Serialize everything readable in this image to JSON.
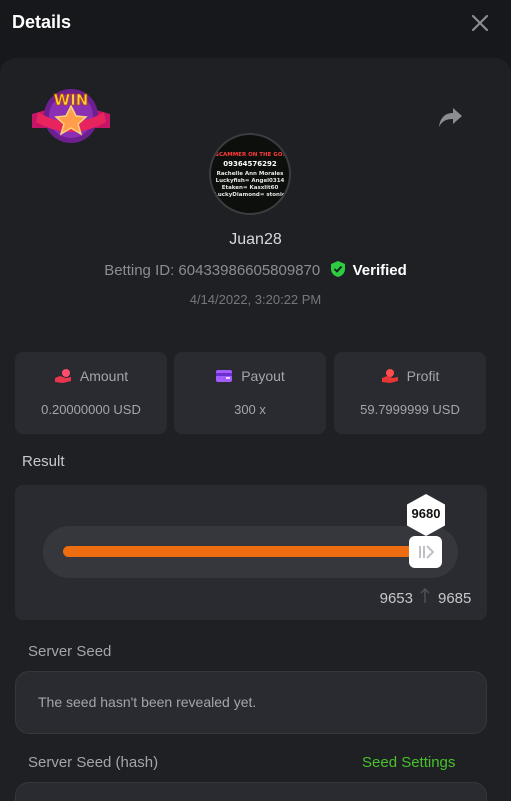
{
  "header": {
    "title": "Details"
  },
  "badge": {
    "text": "WIN"
  },
  "avatar": {
    "lines": [
      "SCAMMER ON THE GO!",
      "09364576292",
      "Rachelle Ann Morales",
      "Luckyfish= Angel0314",
      "Etaken= Kasxlit60",
      "LuckyDiamond= stonio"
    ]
  },
  "user": {
    "username": "Juan28",
    "betting_id_label": "Betting ID:",
    "betting_id": "60433986605809870",
    "verified_label": "Verified",
    "date": "4/14/2022, 3:20:22 PM"
  },
  "stats": [
    {
      "label": "Amount",
      "value": "0.20000000 USD",
      "icon": "hand-coin-icon"
    },
    {
      "label": "Payout",
      "value": "300 x",
      "icon": "wallet-icon"
    },
    {
      "label": "Profit",
      "value": "59.7999999 USD",
      "icon": "hand-profit-icon"
    }
  ],
  "result": {
    "title": "Result",
    "value": "9680",
    "min": "9653",
    "max": "9685"
  },
  "server_seed": {
    "title": "Server Seed",
    "text": "The seed hasn't been revealed yet."
  },
  "server_seed_hash": {
    "title": "Server Seed (hash)",
    "settings_label": "Seed Settings"
  },
  "colors": {
    "accent": "#ee6d10",
    "verified": "#2ecc40",
    "link": "#48c12b",
    "panel": "#1f2024",
    "card": "#2a2b30"
  }
}
